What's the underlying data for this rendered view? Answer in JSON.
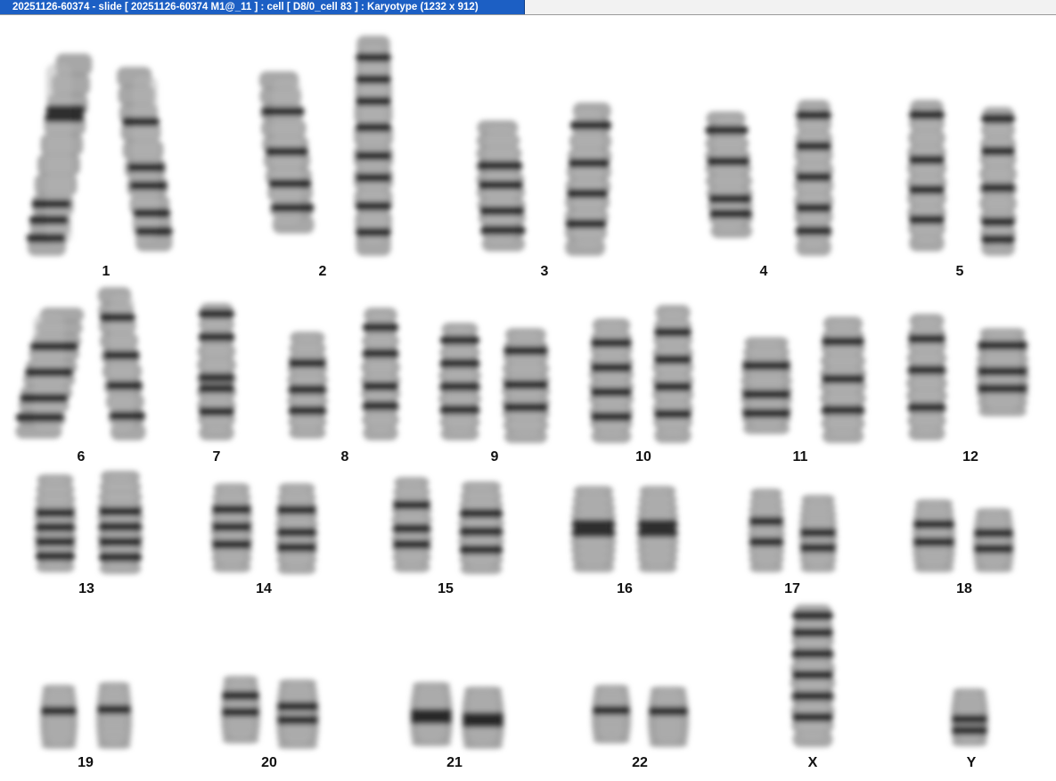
{
  "window": {
    "title": "20251126-60374 - slide [ 20251126-60374 M1@_11 ] : cell [ D8/0_cell 83 ] : Karyotype  (1232 x 912)"
  },
  "karyotype": {
    "chromosome_labels": [
      "1",
      "2",
      "3",
      "4",
      "5",
      "6",
      "7",
      "8",
      "9",
      "10",
      "11",
      "12",
      "13",
      "14",
      "15",
      "16",
      "17",
      "18",
      "19",
      "20",
      "21",
      "22",
      "X",
      "Y"
    ]
  }
}
